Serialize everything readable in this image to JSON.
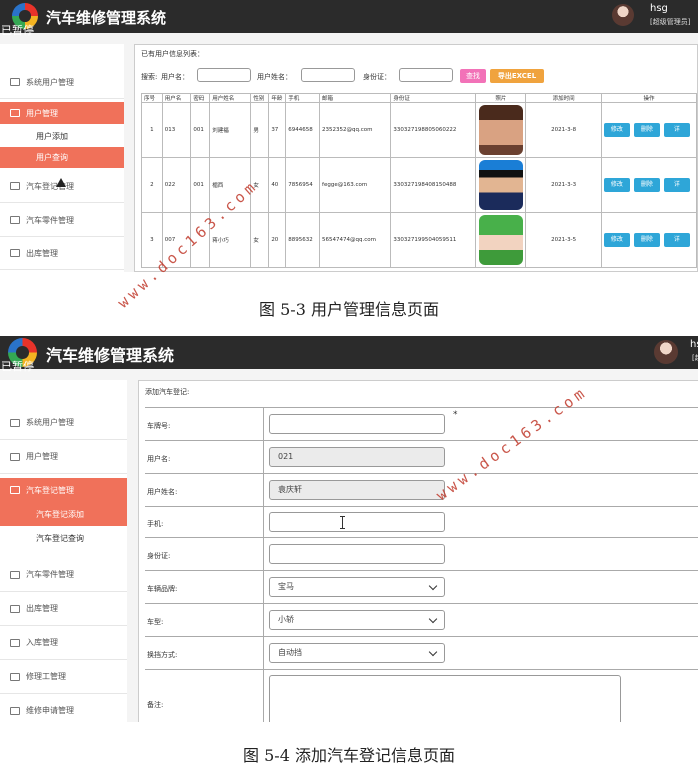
{
  "screen1": {
    "app_title": "汽车维修管理系统",
    "paused_label": "已暂停",
    "user": {
      "name": "hsg",
      "role": "[超级管理员]"
    },
    "sidebar": {
      "items": [
        {
          "label": "系统用户管理"
        },
        {
          "label": "用户管理"
        },
        {
          "label": "汽车登记管理"
        },
        {
          "label": "汽车零件管理"
        },
        {
          "label": "出库管理"
        }
      ],
      "subitems": [
        {
          "label": "用户添加"
        },
        {
          "label": "用户查询"
        }
      ]
    },
    "main": {
      "heading": "已有用户信息列表：",
      "search_label": "搜索:",
      "filters": [
        {
          "label": "用户名："
        },
        {
          "label": "用户姓名："
        },
        {
          "label": "身份证："
        }
      ],
      "search_button": "查找",
      "export_button": "导出EXCEL",
      "columns": [
        "序号",
        "用户名",
        "密码",
        "用户姓名",
        "性别",
        "年龄",
        "手机",
        "邮箱",
        "身份证",
        "照片",
        "添加时间",
        "操作"
      ],
      "rows": [
        {
          "no": "1",
          "username": "013",
          "password": "001",
          "name": "刘建福",
          "gender": "男",
          "age": "37",
          "phone": "6944658",
          "email": "2352352@qq.com",
          "id": "330327198805060222",
          "time": "2021-3-8"
        },
        {
          "no": "2",
          "username": "022",
          "password": "001",
          "name": "楣西",
          "gender": "女",
          "age": "40",
          "phone": "7856954",
          "email": "fegge@163.com",
          "id": "330327198408150488",
          "time": "2021-3-3"
        },
        {
          "no": "3",
          "username": "007",
          "password": "",
          "name": "蒋小巧",
          "gender": "女",
          "age": "20",
          "phone": "8895632",
          "email": "56547474@qq.com",
          "id": "330327199504059511",
          "time": "2021-3-5"
        }
      ],
      "actions": {
        "edit": "修改",
        "delete": "删除",
        "detail": "详"
      }
    }
  },
  "caption1": "图 5-3 用户管理信息页面",
  "screen2": {
    "app_title": "汽车维修管理系统",
    "paused_label": "已暂停",
    "user": {
      "name": "hsg",
      "role": "[超"
    },
    "sidebar": {
      "items": [
        {
          "label": "系统用户管理"
        },
        {
          "label": "用户管理"
        },
        {
          "label": "汽车登记管理"
        },
        {
          "label": "汽车零件管理"
        },
        {
          "label": "出库管理"
        },
        {
          "label": "入库管理"
        },
        {
          "label": "修理工管理"
        },
        {
          "label": "维修申请管理"
        }
      ],
      "subitems": [
        {
          "label": "汽车登记添加"
        },
        {
          "label": "汽车登记查询"
        }
      ]
    },
    "form": {
      "heading": "添加汽车登记:",
      "required_mark": "*",
      "fields": [
        {
          "label": "车牌号:",
          "value": ""
        },
        {
          "label": "用户名:",
          "value": "021"
        },
        {
          "label": "用户姓名:",
          "value": "袁庆轩"
        },
        {
          "label": "手机:",
          "value": ""
        },
        {
          "label": "身份证:",
          "value": ""
        },
        {
          "label": "车辆品牌:",
          "value": "宝马"
        },
        {
          "label": "车型:",
          "value": "小轿"
        },
        {
          "label": "换挡方式:",
          "value": "自动挡"
        },
        {
          "label": "备注:",
          "value": ""
        }
      ]
    }
  },
  "caption2": "图 5-4 添加汽车登记信息页面",
  "watermark": "www.doc163.com"
}
